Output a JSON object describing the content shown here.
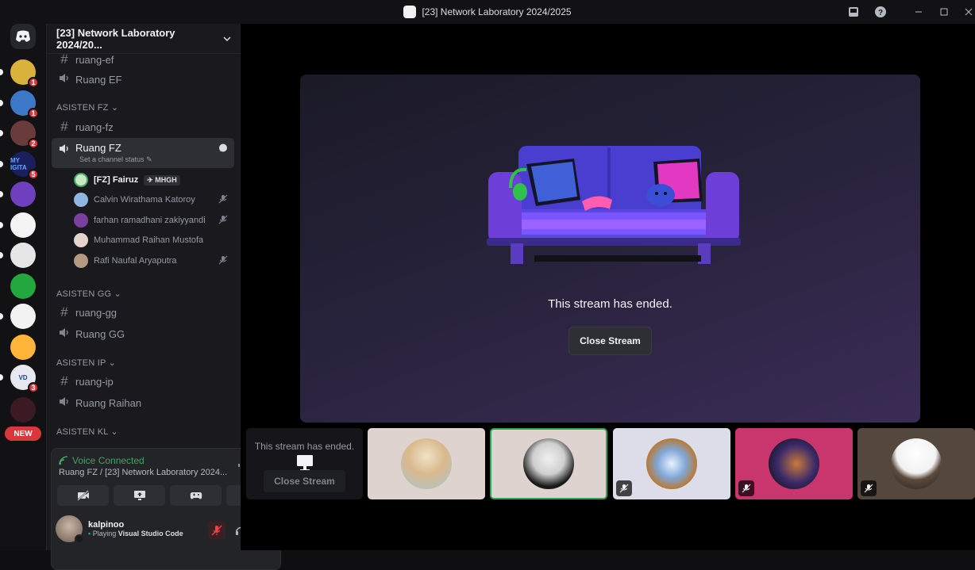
{
  "window": {
    "title": "[23] Network Laboratory 2024/2025"
  },
  "rail": {
    "servers": [
      {
        "badge": "1",
        "color": "#d8b23a"
      },
      {
        "badge": "1",
        "color": "#3c77c8"
      },
      {
        "badge": "2",
        "color": "#6a3b3b"
      },
      {
        "badge": "5",
        "color": "#1b1f5c",
        "label": "MY IGITA"
      },
      {
        "badge": "",
        "color": "#6e3fbf"
      },
      {
        "badge": "",
        "color": "#f4f4f4"
      },
      {
        "badge": "",
        "color": "#e6e6e6"
      },
      {
        "badge": "",
        "color": "#22a83f"
      },
      {
        "badge": "",
        "color": "#f2f2f2"
      },
      {
        "badge": "",
        "color": "#ffb43a"
      },
      {
        "badge": "3",
        "color": "#e8e8f0",
        "label": "VD"
      },
      {
        "badge": "",
        "color": "#3c1a24"
      }
    ],
    "new_label": "NEW"
  },
  "sidebar": {
    "server_name": "[23] Network Laboratory 2024/20...",
    "channels": {
      "ruang_ef_text": "ruang-ef",
      "ruang_ef_voice": "Ruang EF",
      "cat_fz": "ASISTEN FZ",
      "ruang_fz_text": "ruang-fz",
      "ruang_fz_voice": "Ruang FZ",
      "status_hint": "Set a channel status",
      "cat_gg": "ASISTEN GG",
      "ruang_gg_text": "ruang-gg",
      "ruang_gg_voice": "Ruang GG",
      "cat_ip": "ASISTEN IP",
      "ruang_ip_text": "ruang-ip",
      "ruang_raihan_voice": "Ruang Raihan",
      "cat_kl": "ASISTEN KL"
    },
    "voice_users": [
      {
        "name": "[FZ] Fairuz",
        "tag": "MHGH",
        "color": "#c7e8c0",
        "muted": false
      },
      {
        "name": "Calvin Wirathama Katoroy",
        "tag": "",
        "color": "#8fb6e0",
        "muted": true
      },
      {
        "name": "farhan ramadhani zakiyyandi",
        "tag": "",
        "color": "#7b3fa0",
        "muted": true
      },
      {
        "name": "Muhammad Raihan Mustofa",
        "tag": "",
        "color": "#e6d4cc",
        "muted": false
      },
      {
        "name": "Rafi Naufal Aryaputra",
        "tag": "",
        "color": "#b59a80",
        "muted": true
      }
    ]
  },
  "voice_panel": {
    "status": "Voice Connected",
    "channel": "Ruang FZ / [23] Network Laboratory 2024...",
    "username": "kalpinoo",
    "activity_prefix": "Playing",
    "activity": "Visual Studio Code"
  },
  "stage": {
    "message": "This stream has ended.",
    "close_label": "Close Stream"
  },
  "tiles": {
    "mini_message": "This stream has ended.",
    "mini_close": "Close Stream"
  },
  "colors": {
    "accent_green": "#45a366",
    "danger": "#f23f43",
    "badge_red": "#da373c"
  }
}
